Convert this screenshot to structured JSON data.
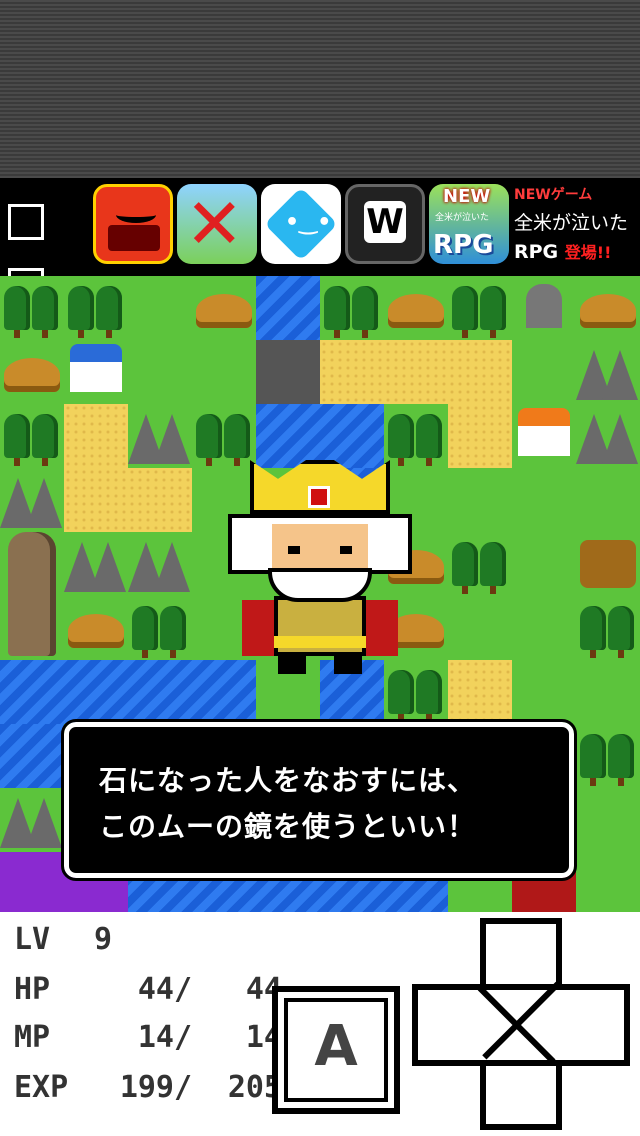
{
  "ad_bar": {
    "apps": [
      {
        "icon": "bathtub-game-icon"
      },
      {
        "icon": "warrior-game-icon"
      },
      {
        "icon": "blue-diamond-face-icon"
      },
      {
        "icon": "w-logo-icon",
        "text": "W"
      },
      {
        "icon": "rpg-game-icon",
        "badge": "NEW",
        "caption": "全米が泣いた",
        "text": "RPG"
      }
    ],
    "promo": {
      "line1": "NEWゲーム",
      "line2": "全米が泣いた",
      "line3_main": "RPG",
      "line3_accent": "登場!!"
    }
  },
  "dialog": {
    "line1": "石になった人をなおすには、",
    "line2": "このムーの鏡を使うといい！"
  },
  "status": {
    "lv": {
      "label": "LV",
      "value": "9"
    },
    "hp": {
      "label": "HP",
      "current": "44",
      "max": "44"
    },
    "mp": {
      "label": "MP",
      "current": "14",
      "max": "14"
    },
    "exp": {
      "label": "EXP",
      "current": "199",
      "max": "205"
    },
    "separator": "/"
  },
  "controls": {
    "a_button_label": "A"
  },
  "colors": {
    "grass": "#5cc43c",
    "water": "#2f7bf0",
    "crown": "#f5d82a",
    "dialog_bg": "#000000",
    "promo_accent": "#ff2020"
  }
}
